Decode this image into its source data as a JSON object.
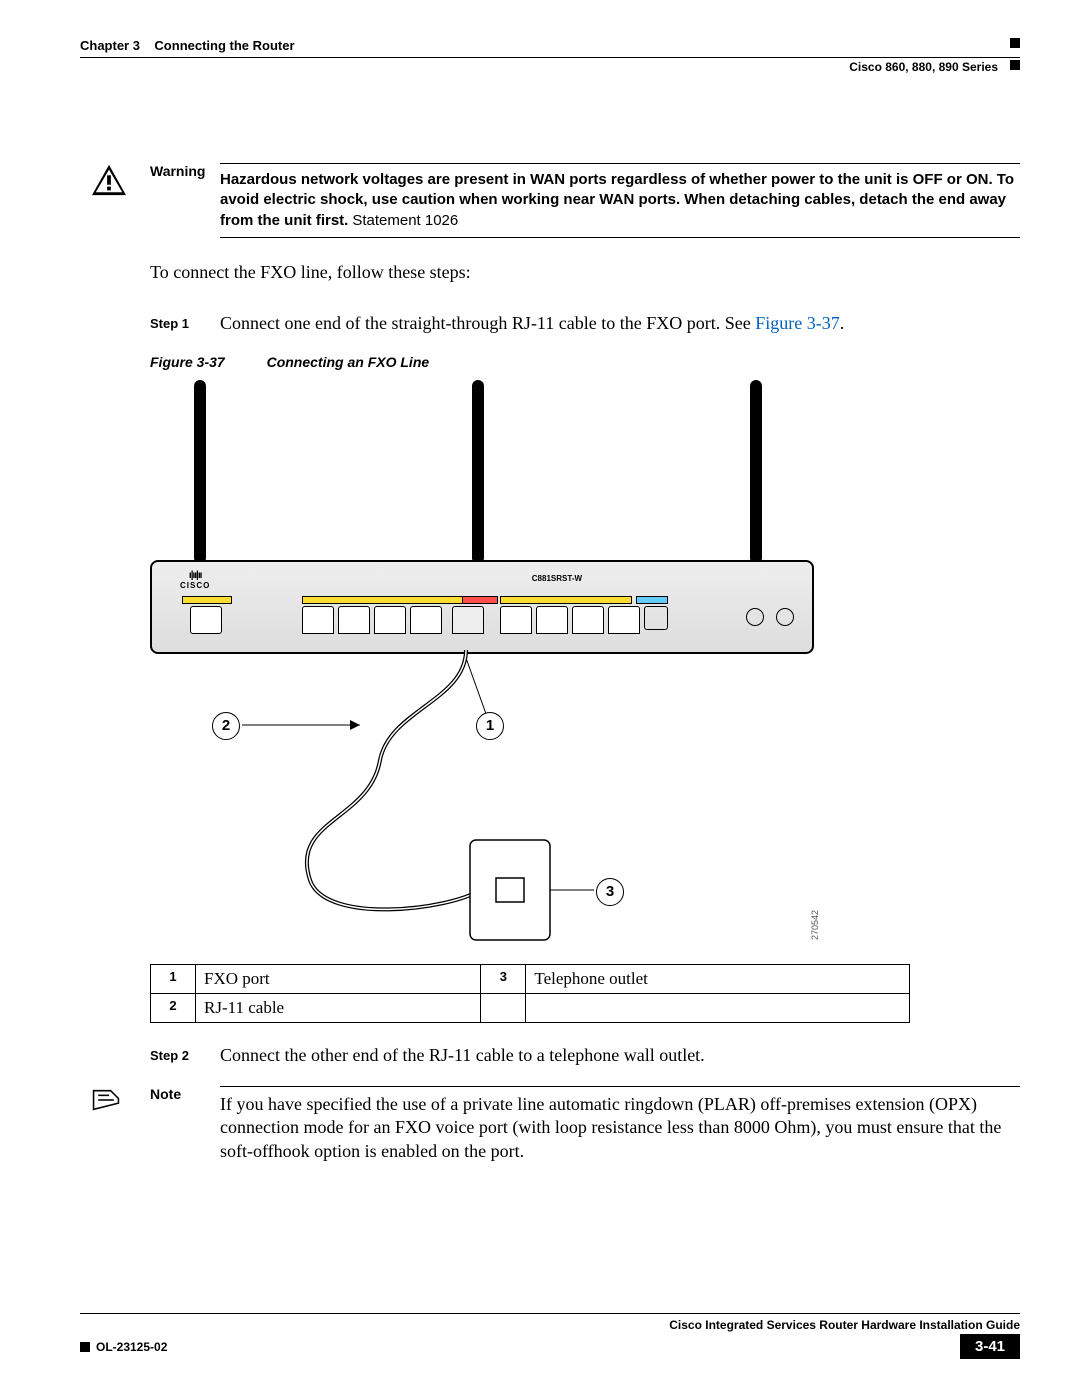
{
  "header": {
    "chapter_prefix": "Chapter 3",
    "chapter_title": "Connecting the Router",
    "series": "Cisco 860, 880, 890 Series"
  },
  "warning": {
    "label": "Warning",
    "text_bold": "Hazardous network voltages are present in WAN ports regardless of whether power to the unit is OFF or ON. To avoid electric shock, use caution when working near WAN ports. When detaching cables, detach the end away from the unit first.",
    "statement": "Statement 1026"
  },
  "intro": "To connect the FXO line, follow these steps:",
  "step1": {
    "label": "Step 1",
    "text_before": "Connect one end of the straight-through RJ-11 cable to the FXO port. See ",
    "link": "Figure 3-37",
    "text_after": "."
  },
  "figure": {
    "number": "Figure 3-37",
    "title": "Connecting an FXO Line",
    "device_model": "C881SRST-W",
    "cisco_brand": "CISCO",
    "image_id": "270542",
    "callouts": {
      "c1": "1",
      "c2": "2",
      "c3": "3"
    },
    "legend": [
      {
        "k": "1",
        "v": "FXO port"
      },
      {
        "k": "2",
        "v": "RJ-11 cable"
      },
      {
        "k": "3",
        "v": "Telephone outlet"
      }
    ]
  },
  "step2": {
    "label": "Step 2",
    "text": "Connect the other end of the RJ-11 cable to a telephone wall outlet."
  },
  "note": {
    "label": "Note",
    "text": "If you have specified the use of a private line automatic ringdown (PLAR) off-premises extension (OPX) connection mode for an FXO voice port (with loop resistance less than 8000 Ohm), you must ensure that the soft-offhook option is enabled on the port."
  },
  "footer": {
    "guide": "Cisco Integrated Services Router Hardware Installation Guide",
    "doc_id": "OL-23125-02",
    "page": "3-41"
  }
}
